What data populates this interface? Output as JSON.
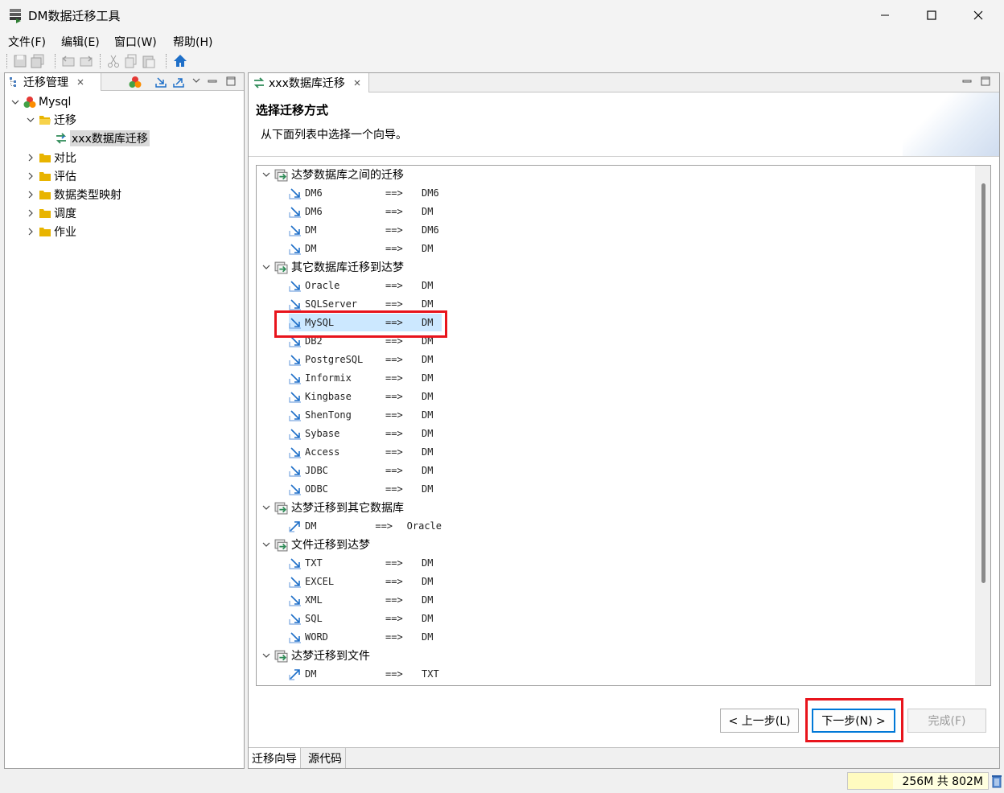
{
  "window": {
    "title": "DM数据迁移工具"
  },
  "menubar": [
    "文件(F)",
    "编辑(E)",
    "窗口(W)",
    "帮助(H)"
  ],
  "left_panel": {
    "tab_label": "迁移管理",
    "tree": {
      "root": "Mysql",
      "children": [
        {
          "label": "迁移",
          "expanded": true,
          "children": [
            {
              "label": "xxx数据库迁移",
              "selected": true
            }
          ]
        },
        {
          "label": "对比"
        },
        {
          "label": "评估"
        },
        {
          "label": "数据类型映射"
        },
        {
          "label": "调度"
        },
        {
          "label": "作业"
        }
      ]
    }
  },
  "editor": {
    "tab_label": "xxx数据库迁移",
    "wizard_title": "选择迁移方式",
    "wizard_description": "从下面列表中选择一个向导。",
    "groups": [
      {
        "label": "达梦数据库之间的迁移",
        "items": [
          {
            "src": "DM6",
            "arrow": "==>",
            "dst": "DM6"
          },
          {
            "src": "DM6",
            "arrow": "==>",
            "dst": "DM"
          },
          {
            "src": "DM",
            "arrow": "==>",
            "dst": "DM6"
          },
          {
            "src": "DM",
            "arrow": "==>",
            "dst": "DM"
          }
        ]
      },
      {
        "label": "其它数据库迁移到达梦",
        "items": [
          {
            "src": "Oracle",
            "arrow": "==>",
            "dst": "DM"
          },
          {
            "src": "SQLServer",
            "arrow": "==>",
            "dst": "DM"
          },
          {
            "src": "MySQL",
            "arrow": "==>",
            "dst": "DM",
            "selected": true
          },
          {
            "src": "DB2",
            "arrow": "==>",
            "dst": "DM"
          },
          {
            "src": "PostgreSQL",
            "arrow": "==>",
            "dst": "DM"
          },
          {
            "src": "Informix",
            "arrow": "==>",
            "dst": "DM"
          },
          {
            "src": "Kingbase",
            "arrow": "==>",
            "dst": "DM"
          },
          {
            "src": "ShenTong",
            "arrow": "==>",
            "dst": "DM"
          },
          {
            "src": "Sybase",
            "arrow": "==>",
            "dst": "DM"
          },
          {
            "src": "Access",
            "arrow": "==>",
            "dst": "DM"
          },
          {
            "src": "JDBC",
            "arrow": "==>",
            "dst": "DM"
          },
          {
            "src": "ODBC",
            "arrow": "==>",
            "dst": "DM"
          }
        ]
      },
      {
        "label": "达梦迁移到其它数据库",
        "items": [
          {
            "src": "DM",
            "arrow": "==>",
            "dst": "Oracle",
            "outbound": true
          }
        ]
      },
      {
        "label": "文件迁移到达梦",
        "items": [
          {
            "src": "TXT",
            "arrow": "==>",
            "dst": "DM"
          },
          {
            "src": "EXCEL",
            "arrow": "==>",
            "dst": "DM"
          },
          {
            "src": "XML",
            "arrow": "==>",
            "dst": "DM"
          },
          {
            "src": "SQL",
            "arrow": "==>",
            "dst": "DM"
          },
          {
            "src": "WORD",
            "arrow": "==>",
            "dst": "DM"
          }
        ]
      },
      {
        "label": "达梦迁移到文件",
        "items": [
          {
            "src": "DM",
            "arrow": "==>",
            "dst": "TXT",
            "outbound": true
          }
        ]
      }
    ],
    "buttons": {
      "back": "< 上一步(L)",
      "next": "下一步(N) >",
      "finish": "完成(F)"
    },
    "bottom_tabs": [
      "迁移向导",
      "源代码"
    ]
  },
  "statusbar": {
    "heap": "256M 共 802M",
    "heap_fraction": 0.32
  },
  "colors": {
    "highlight": "#e8141c",
    "selection": "#cce8ff",
    "accent": "#0078d7",
    "folder": "#e8b400"
  }
}
